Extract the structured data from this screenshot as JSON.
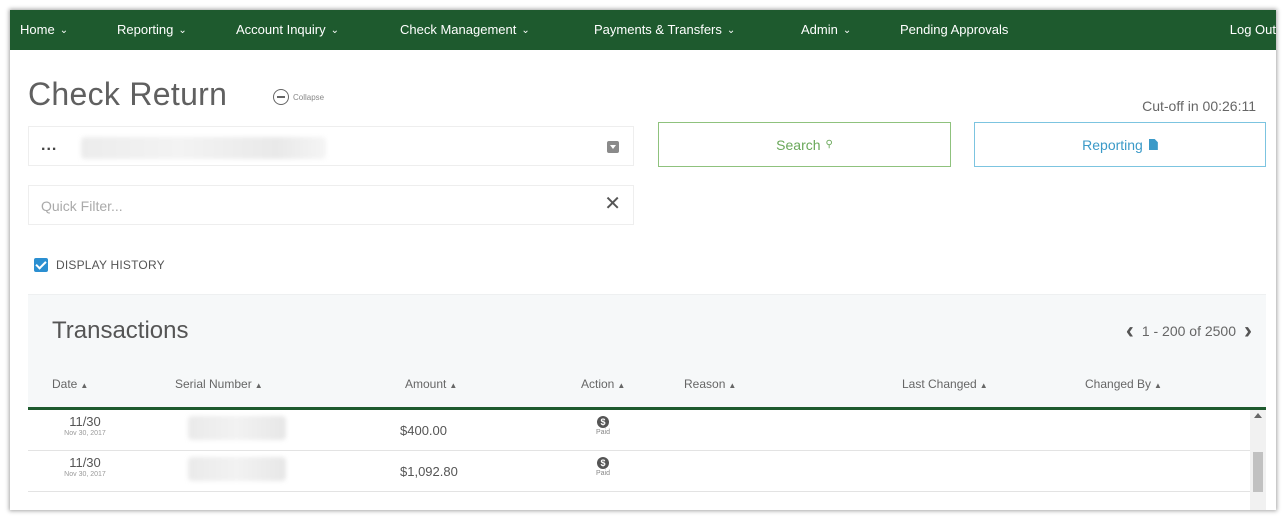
{
  "nav": {
    "items": [
      {
        "label": "Home",
        "chevron": true
      },
      {
        "label": "Reporting",
        "chevron": true
      },
      {
        "label": "Account Inquiry",
        "chevron": true
      },
      {
        "label": "Check Management",
        "chevron": true
      },
      {
        "label": "Payments & Transfers",
        "chevron": true
      },
      {
        "label": "Admin",
        "chevron": true
      },
      {
        "label": "Pending Approvals",
        "chevron": false
      }
    ],
    "logout_label": "Log Out",
    "background": "#1e5a2e"
  },
  "page": {
    "title": "Check Return",
    "collapse_label": "Collapse",
    "cutoff_text": "Cut-off in 00:26:11"
  },
  "account_select": {
    "value_prefix": "..."
  },
  "buttons": {
    "search_label": "Search",
    "reporting_label": "Reporting"
  },
  "quick_filter": {
    "placeholder": "Quick Filter...",
    "value": ""
  },
  "display_history": {
    "label": "DISPLAY HISTORY",
    "checked": true
  },
  "transactions": {
    "title": "Transactions",
    "pagination": "1 - 200 of 2500",
    "columns": [
      "Date",
      "Serial Number",
      "Amount",
      "Action",
      "Reason",
      "Last Changed",
      "Changed By"
    ],
    "rows": [
      {
        "date": "11/30",
        "date_full": "Nov 30, 2017",
        "amount": "$400.00",
        "action": "Paid"
      },
      {
        "date": "11/30",
        "date_full": "Nov 30, 2017",
        "amount": "$1,092.80",
        "action": "Paid"
      }
    ]
  },
  "colors": {
    "search_accent": "#8fc27d",
    "reporting_accent": "#3b9ac8",
    "checkbox": "#2b8fd1"
  }
}
